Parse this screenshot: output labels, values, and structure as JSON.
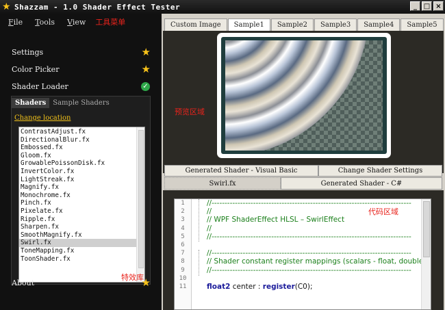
{
  "window": {
    "title": "Shazzam - 1.0 Shader Effect Tester",
    "controls": {
      "minimize": "_",
      "maximize": "□",
      "close": "×"
    }
  },
  "menu": {
    "items": [
      {
        "label": "File",
        "mnemonic": "F",
        "rest": "ile"
      },
      {
        "label": "Tools",
        "mnemonic": "T",
        "rest": "ools"
      },
      {
        "label": "View",
        "mnemonic": "V",
        "rest": "iew"
      }
    ],
    "annotation": "工具菜单"
  },
  "sidebar": {
    "settings": "Settings",
    "color_picker": "Color Picker",
    "shader_loader": "Shader Loader",
    "about": "About"
  },
  "loader": {
    "tabs": [
      "Shaders",
      "Sample Shaders"
    ],
    "change_location": "Change location",
    "annotation": "特效库",
    "selected": "Swirl.fx",
    "files": [
      "ContrastAdjust.fx",
      "DirectionalBlur.fx",
      "Embossed.fx",
      "Gloom.fx",
      "GrowablePoissonDisk.fx",
      "InvertColor.fx",
      "LightStreak.fx",
      "Magnify.fx",
      "Monochrome.fx",
      "Pinch.fx",
      "Pixelate.fx",
      "Ripple.fx",
      "Sharpen.fx",
      "SmoothMagnify.fx",
      "Swirl.fx",
      "ToneMapping.fx",
      "ToonShader.fx"
    ]
  },
  "preview": {
    "tabs": [
      "Custom Image",
      "Sample1",
      "Sample2",
      "Sample3",
      "Sample4",
      "Sample5"
    ],
    "active_tab": "Sample1",
    "annotation": "预览区域"
  },
  "generated": {
    "tabs_row1": [
      "Generated Shader - Visual Basic",
      "Change Shader Settings"
    ],
    "tabs_row2": [
      "Swirl.fx",
      "Generated Shader - C#"
    ],
    "active_tab": "Swirl.fx",
    "annotation": "代码区域"
  },
  "code": {
    "line_numbers": [
      "1",
      "2",
      "3",
      "4",
      "5",
      "6",
      "7",
      "8",
      "9",
      "10",
      "11"
    ],
    "lines": [
      {
        "type": "comment",
        "text": "//-----------------------------------------------------------------------------"
      },
      {
        "type": "comment",
        "text": "//"
      },
      {
        "type": "comment",
        "text": "// WPF ShaderEffect HLSL – SwirlEffect"
      },
      {
        "type": "comment",
        "text": "//"
      },
      {
        "type": "comment",
        "text": "//-----------------------------------------------------------------------------"
      },
      {
        "type": "blank",
        "text": ""
      },
      {
        "type": "comment",
        "text": "//-----------------------------------------------------------------------------"
      },
      {
        "type": "comment",
        "text": "// Shader constant register mappings (scalars - float, double, Po"
      },
      {
        "type": "comment",
        "text": "//-----------------------------------------------------------------------------"
      },
      {
        "type": "blank",
        "text": ""
      },
      {
        "type": "decl",
        "kw": "float2",
        "name": " center : ",
        "fn": "register",
        "rest": "(C0);"
      }
    ]
  },
  "colors": {
    "annotation_red": "#e8231c",
    "star_gold": "#f7c21a",
    "link_gold": "#f2c21a",
    "comment_green": "#1a7f1a",
    "keyword_blue": "#1a1a9a"
  }
}
